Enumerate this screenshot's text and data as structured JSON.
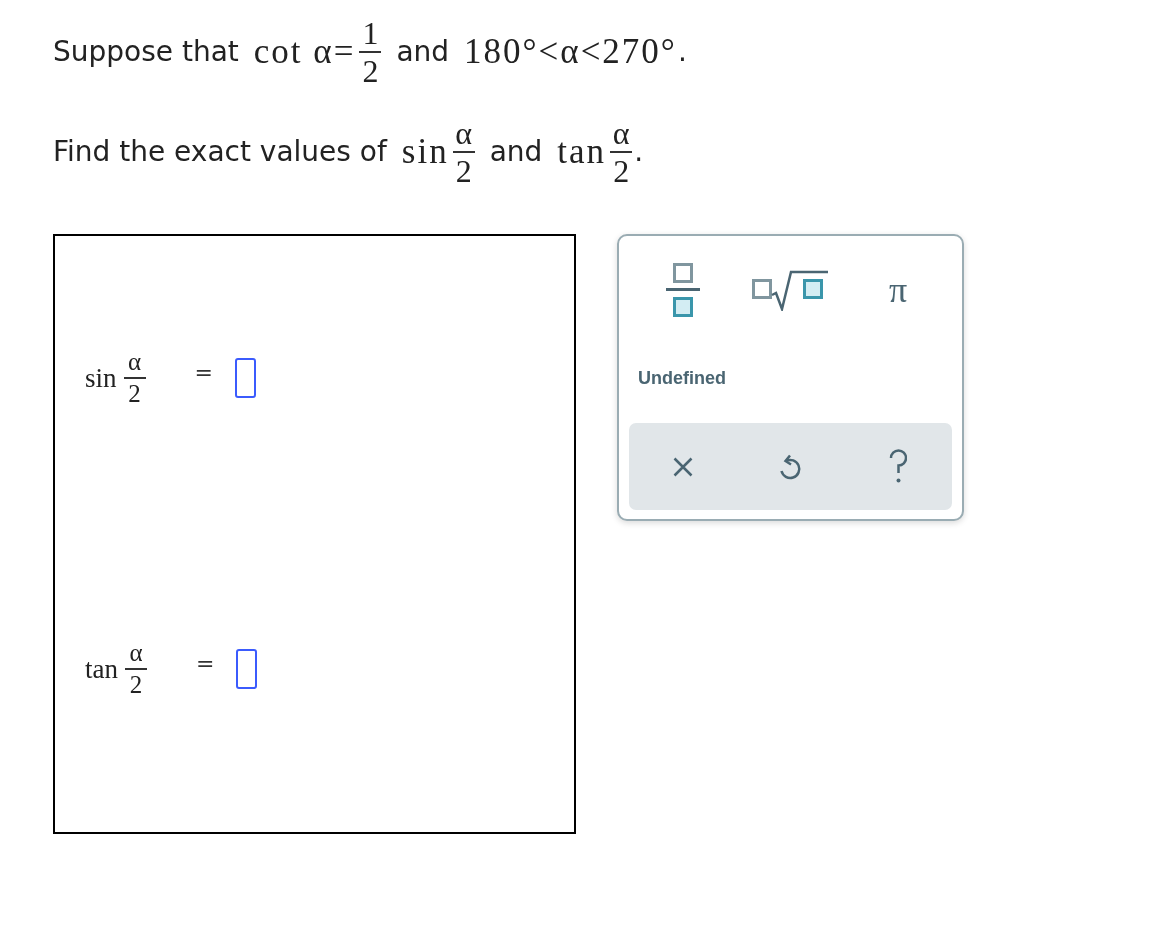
{
  "problem": [
    {
      "segments": [
        {
          "kind": "text",
          "text": "Suppose that"
        },
        {
          "kind": "math",
          "text": "cot α="
        },
        {
          "kind": "fraction",
          "numerator": "1",
          "denominator": "2"
        },
        {
          "kind": "text",
          "text": "and"
        },
        {
          "kind": "math",
          "text": "180°<α<270°"
        },
        {
          "kind": "punct",
          "text": "."
        }
      ]
    },
    {
      "segments": [
        {
          "kind": "text",
          "text": "Find the exact values of"
        },
        {
          "kind": "math",
          "text": "sin"
        },
        {
          "kind": "fraction",
          "numerator": "α",
          "denominator": "2"
        },
        {
          "kind": "text",
          "text": "and"
        },
        {
          "kind": "math",
          "text": "tan"
        },
        {
          "kind": "fraction",
          "numerator": "α",
          "denominator": "2"
        },
        {
          "kind": "punct",
          "text": "."
        }
      ]
    }
  ],
  "answer_panel": {
    "rows": [
      {
        "function": "sin",
        "numerator": "α",
        "denominator": "2",
        "equals": "="
      },
      {
        "function": "tan",
        "numerator": "α",
        "denominator": "2",
        "equals": "="
      }
    ]
  },
  "keypad": {
    "tools": [
      {
        "kind": "fraction"
      },
      {
        "kind": "root"
      },
      {
        "kind": "symbol",
        "text": "π"
      }
    ],
    "undefined_button": "Undefined",
    "actions": [
      {
        "kind": "clear"
      },
      {
        "kind": "undo"
      },
      {
        "kind": "help"
      }
    ]
  }
}
